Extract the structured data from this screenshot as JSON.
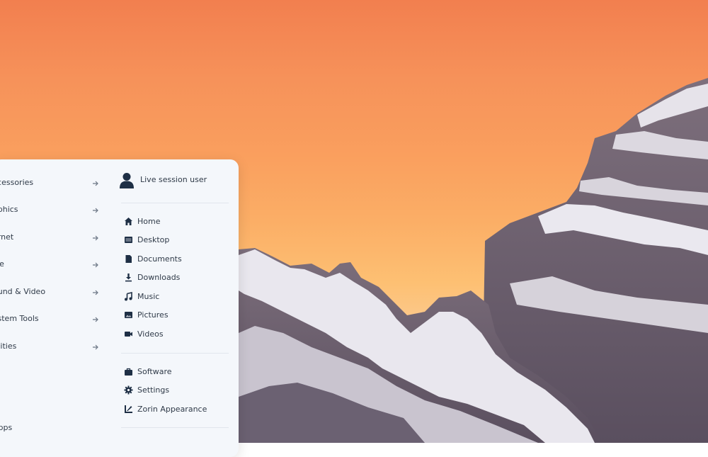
{
  "menu": {
    "categories": [
      {
        "label": "ccessories",
        "icon": "arrow-right-icon"
      },
      {
        "label": "aphics",
        "icon": "arrow-right-icon"
      },
      {
        "label": "ernet",
        "icon": "arrow-right-icon"
      },
      {
        "label": "ice",
        "icon": "arrow-right-icon"
      },
      {
        "label": "ound & Video",
        "icon": "arrow-right-icon"
      },
      {
        "label": "ystem Tools",
        "icon": "arrow-right-icon"
      },
      {
        "label": "tilities",
        "icon": "arrow-right-icon"
      }
    ],
    "all_apps_label": "Apps",
    "user": {
      "name": "Live session user",
      "icon": "user-icon"
    },
    "places": [
      {
        "label": "Home",
        "icon": "home-icon"
      },
      {
        "label": "Desktop",
        "icon": "desktop-icon"
      },
      {
        "label": "Documents",
        "icon": "document-icon"
      },
      {
        "label": "Downloads",
        "icon": "download-icon"
      },
      {
        "label": "Music",
        "icon": "music-icon"
      },
      {
        "label": "Pictures",
        "icon": "picture-icon"
      },
      {
        "label": "Videos",
        "icon": "video-icon"
      }
    ],
    "system": [
      {
        "label": "Software",
        "icon": "software-bag-icon"
      },
      {
        "label": "Settings",
        "icon": "gear-icon"
      },
      {
        "label": "Zorin Appearance",
        "icon": "appearance-icon"
      }
    ]
  },
  "colors": {
    "menu_bg": "#f4f7fb",
    "text": "#2f3a48",
    "icon": "#1e2f45",
    "sky_top": "#f27f4f",
    "sky_bottom": "#fcd9b9"
  }
}
